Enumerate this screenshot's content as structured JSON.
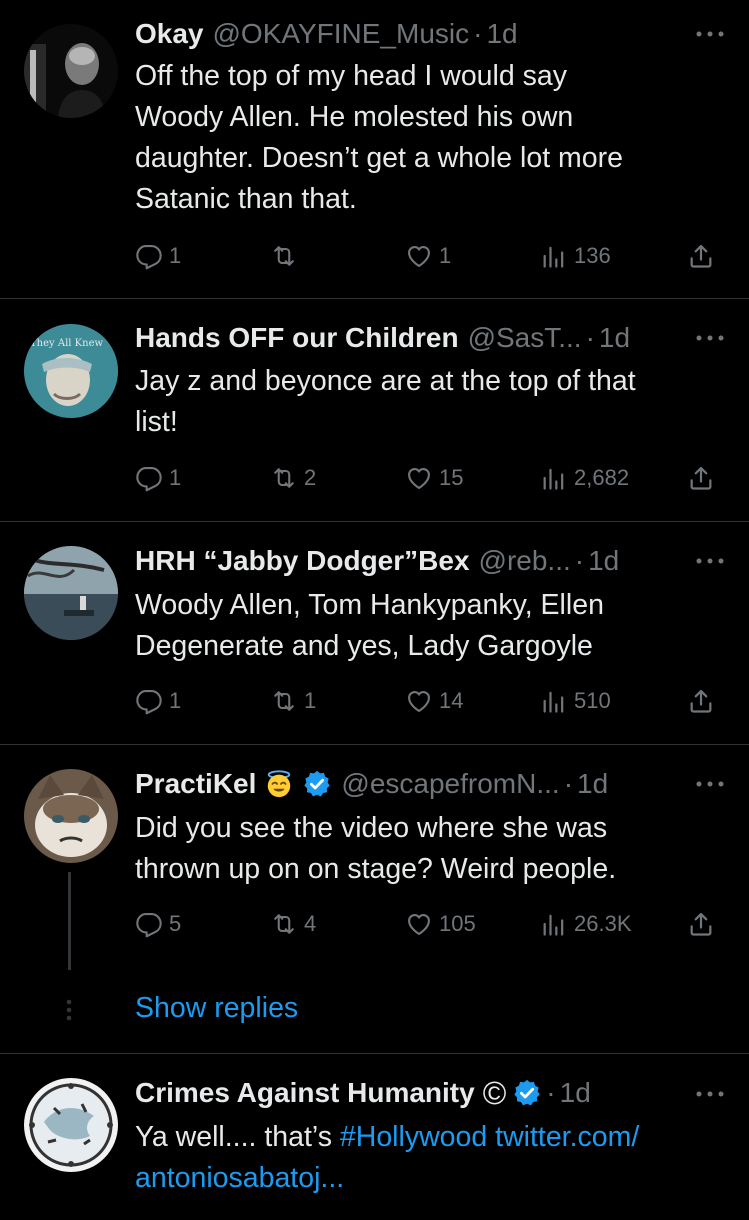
{
  "tweets": [
    {
      "name": "Okay",
      "handle": "@OKAYFINE_Music",
      "dot": "·",
      "time": "1d",
      "lines": [
        "Off the top of my head I would say",
        "Woody Allen. He molested his own",
        "daughter. Doesn’t get a whole lot more",
        "Satanic than that."
      ],
      "replies": "1",
      "retweets": "",
      "likes": "1",
      "views": "136"
    },
    {
      "name": "Hands OFF our Children",
      "handle": "@SasT...",
      "dot": "·",
      "time": "1d",
      "avatar_text": "They All Knew",
      "lines": [
        "Jay z and beyonce are at the top of that",
        "list!"
      ],
      "replies": "1",
      "retweets": "2",
      "likes": "15",
      "views": "2,682"
    },
    {
      "name": "HRH “Jabby Dodger”Bex",
      "handle": "@reb...",
      "dot": "·",
      "time": "1d",
      "lines": [
        "Woody Allen, Tom Hankypanky, Ellen",
        "Degenerate and yes, Lady Gargoyle"
      ],
      "replies": "1",
      "retweets": "1",
      "likes": "14",
      "views": "510"
    },
    {
      "name": "PractiKel",
      "handle": "@escapefromN...",
      "dot": "·",
      "time": "1d",
      "lines": [
        "Did you see the video where she was",
        "thrown up on on stage? Weird people."
      ],
      "replies": "5",
      "retweets": "4",
      "likes": "105",
      "views": "26.3K"
    },
    {
      "name": "Crimes Against Humanity",
      "name_symbol": "©",
      "dot": "·",
      "time": "1d",
      "line1_prefix": "Ya well.... that’s",
      "line1_hashtag": "#Hollywood",
      "line1_link": "twitter.com/",
      "line2_link": "antoniosabatoj..."
    }
  ],
  "show_replies": "Show replies",
  "colors": {
    "link": "#1d9bf0",
    "muted": "#71767b",
    "text": "#e7e9ea",
    "divider": "#2f3336",
    "background": "#000000"
  },
  "icons": [
    "reply-icon",
    "retweet-icon",
    "like-icon",
    "views-icon",
    "share-icon",
    "more-icon",
    "verified-badge-icon",
    "halo-emoji-icon"
  ]
}
